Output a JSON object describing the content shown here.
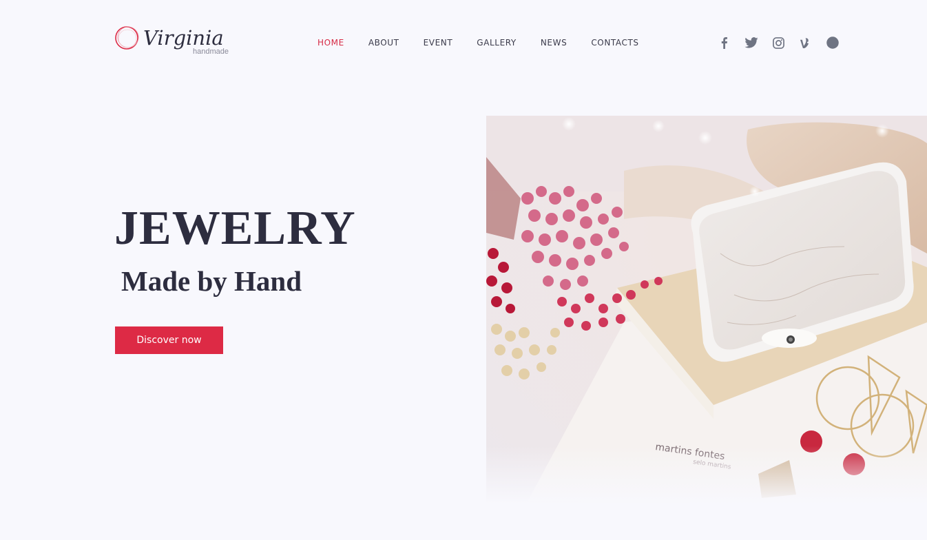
{
  "logo": {
    "name": "Virginia",
    "tagline": "handmade"
  },
  "nav": {
    "items": [
      {
        "label": "HOME",
        "active": true
      },
      {
        "label": "ABOUT",
        "active": false
      },
      {
        "label": "EVENT",
        "active": false
      },
      {
        "label": "GALLERY",
        "active": false
      },
      {
        "label": "NEWS",
        "active": false
      },
      {
        "label": "CONTACTS",
        "active": false
      }
    ]
  },
  "social": [
    "facebook-icon",
    "twitter-icon",
    "instagram-icon",
    "vine-icon",
    "dribbble-icon"
  ],
  "hero": {
    "title": "JEWELRY",
    "subtitle": "Made by Hand",
    "cta_label": "Discover now",
    "image_alt": "Dried flowers, marble phone case on notebooks and gold earrings with red beads"
  },
  "photo_text": {
    "book_title": "martins fontes",
    "book_sub": "selo martins"
  },
  "colors": {
    "accent": "#dd2a45",
    "text": "#2d2d3f",
    "background": "#f8f8fd",
    "icon": "#6f7483"
  }
}
